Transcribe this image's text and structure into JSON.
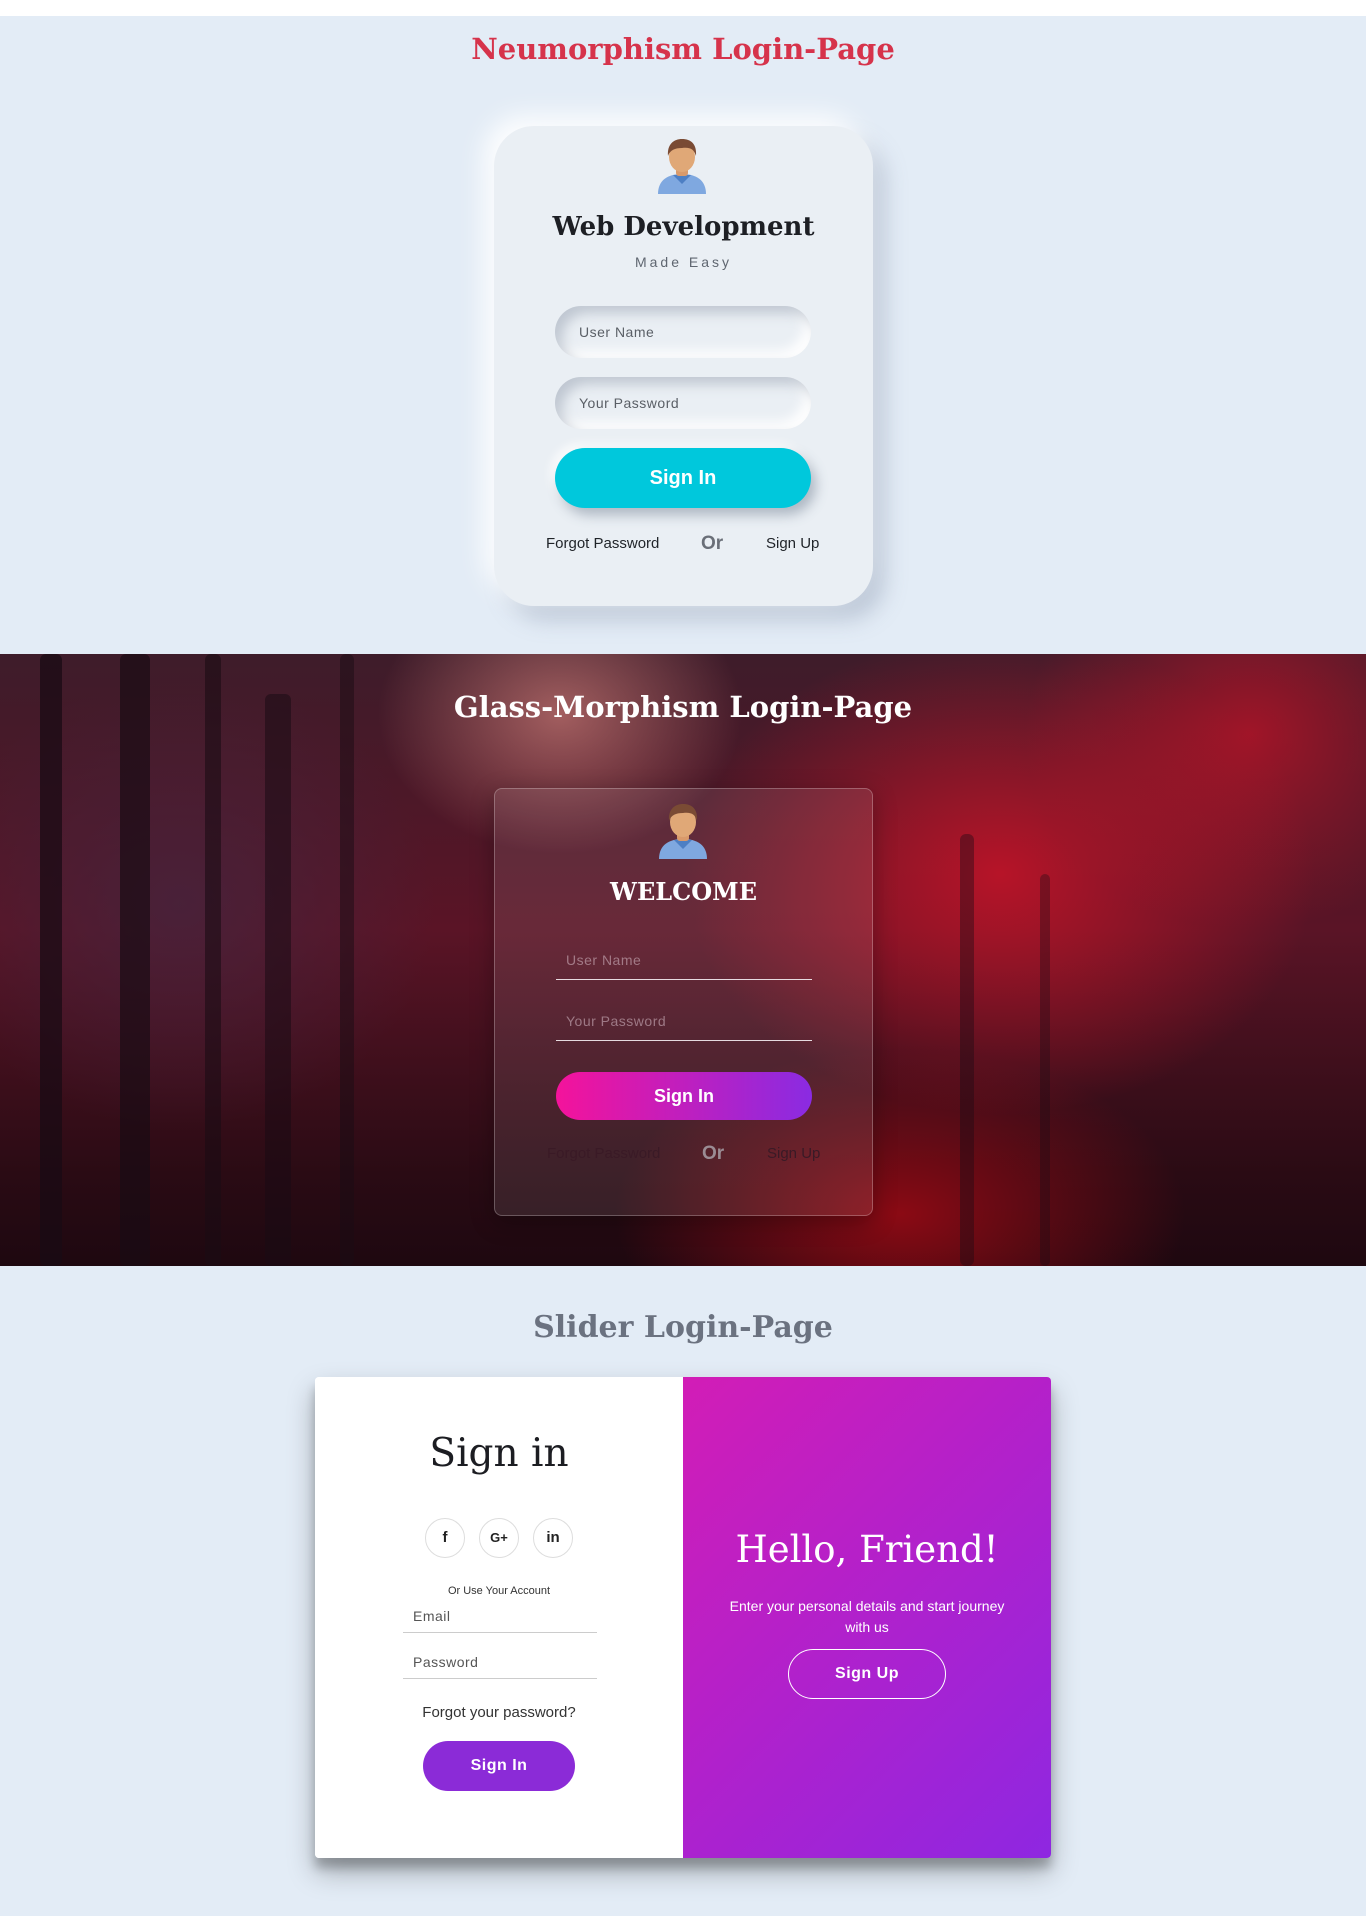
{
  "neumorphism": {
    "title": "Neumorphism Login-Page",
    "heading": "Web Development",
    "subheading": "Made Easy",
    "username_placeholder": "User Name",
    "password_placeholder": "Your Password",
    "signin_label": "Sign In",
    "forgot_label": "Forgot Password",
    "or_label": "Or",
    "signup_label": "Sign Up",
    "accent_color": "#00c8dc",
    "title_color": "#d6334b",
    "avatar_icon": "user-avatar-icon"
  },
  "glassmorphism": {
    "title": "Glass-Morphism Login-Page",
    "heading": "WELCOME",
    "username_placeholder": "User Name",
    "password_placeholder": "Your Password",
    "signin_label": "Sign In",
    "forgot_label": "Forgot Password",
    "or_label": "Or",
    "signup_label": "Sign Up",
    "button_gradient": [
      "#f4139b",
      "#8a2be2"
    ],
    "avatar_icon": "user-avatar-icon"
  },
  "slider": {
    "title": "Slider Login-Page",
    "signin": {
      "heading": "Sign in",
      "social": [
        {
          "icon": "facebook-icon",
          "glyph": "f"
        },
        {
          "icon": "google-plus-icon",
          "glyph": "G+"
        },
        {
          "icon": "linkedin-icon",
          "glyph": "in"
        }
      ],
      "use_account": "Or Use Your Account",
      "email_placeholder": "Email",
      "password_placeholder": "Password",
      "forgot_label": "Forgot your password?",
      "button_label": "Sign In",
      "button_color": "#8b2bd7"
    },
    "overlay": {
      "heading": "Hello, Friend!",
      "text": "Enter your personal details and start journey with us",
      "button_label": "Sign Up",
      "gradient": [
        "#d21db6",
        "#8e27e1"
      ]
    }
  }
}
